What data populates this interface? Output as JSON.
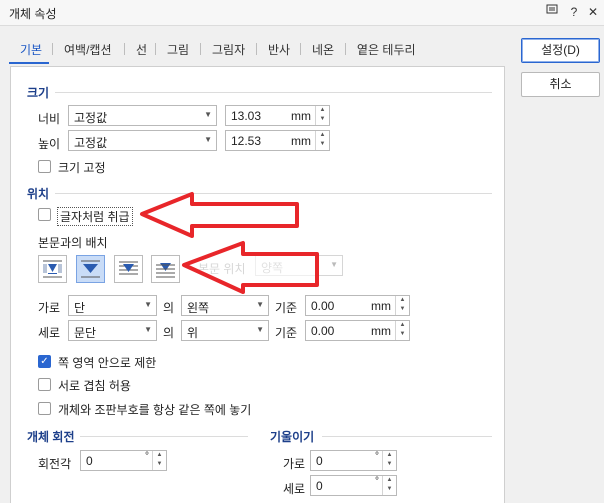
{
  "window": {
    "title": "개체 속성"
  },
  "tabs": [
    "기본",
    "여백/캡션",
    "선",
    "그림",
    "그림자",
    "반사",
    "네온",
    "옅은 테두리"
  ],
  "buttons": {
    "ok": "설정(D)",
    "cancel": "취소"
  },
  "size": {
    "title": "크기",
    "width_label": "너비",
    "width_mode": "고정값",
    "width_value": "13.03",
    "width_unit": "mm",
    "height_label": "높이",
    "height_mode": "고정값",
    "height_value": "12.53",
    "height_unit": "mm",
    "fix_label": "크기 고정"
  },
  "position": {
    "title": "위치",
    "treat_as_char": "글자처럼 취급",
    "wrap_title": "본문과의 배치",
    "text_pos_label": "본문 위치",
    "text_pos_value": "양쪽",
    "horiz": {
      "label": "가로",
      "ref": "단",
      "of": "의",
      "align": "왼쪽",
      "base": "기준",
      "value": "0.00",
      "unit": "mm"
    },
    "vert": {
      "label": "세로",
      "ref": "문단",
      "of": "의",
      "align": "위",
      "base": "기준",
      "value": "0.00",
      "unit": "mm"
    },
    "limit_page": "쪽 영역 안으로 제한",
    "allow_overlap": "서로 겹침 허용",
    "same_page": "개체와 조판부호를 항상 같은 쪽에 놓기"
  },
  "rotation": {
    "title": "개체 회전",
    "label": "회전각",
    "value": "0",
    "unit": "°"
  },
  "skew": {
    "title": "기울이기",
    "h_label": "가로",
    "h_value": "0",
    "v_label": "세로",
    "v_value": "0",
    "unit": "°"
  },
  "colors": {
    "accent": "#2a66d0",
    "section": "#1d3f8a",
    "arrow": "#e8262a"
  }
}
